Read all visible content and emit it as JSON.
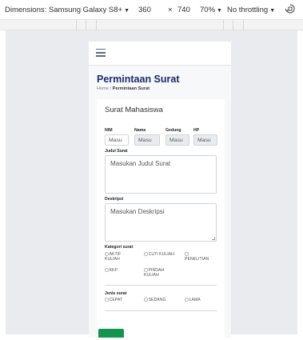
{
  "devtools": {
    "dimensions_label": "Dimensions: Samsung Galaxy S8+",
    "width": "360",
    "times": "×",
    "height": "740",
    "zoom": "70%",
    "throttle": "No throttling",
    "icons": [
      "chevron-down-icon",
      "rotate-icon"
    ]
  },
  "page": {
    "title": "Permintaan Surat",
    "breadcrumb_home": "Home",
    "breadcrumb_sep": "/",
    "breadcrumb_current": "Permintaan Surat"
  },
  "form": {
    "title": "Surat Mahasiswa",
    "nim_label": "NIM",
    "nama_label": "Nama",
    "gedung_label": "Gedung",
    "hp_label": "HP",
    "nim_placeholder": "Masu",
    "nama_placeholder": "Masu",
    "gedung_placeholder": "Masu",
    "hp_placeholder": "Masu",
    "judul_label": "Judul Surat",
    "judul_placeholder": "Masukan Judul Surat",
    "deskripsi_label": "Deskripsi",
    "deskripsi_placeholder": "Masukan Deskripsi",
    "kategori_label": "Kategori surat",
    "kategori_options": [
      "AKTIF KULIAH",
      "CUTI KULIAH",
      "PENELITIAN",
      "KKP",
      "PINDAH KULIAH"
    ],
    "jenis_label": "Jenis surat",
    "jenis_options": [
      "CEPAT",
      "SEDANG",
      "LAMA"
    ]
  },
  "colors": {
    "title": "#1a2a6c",
    "submit": "#13944e"
  }
}
